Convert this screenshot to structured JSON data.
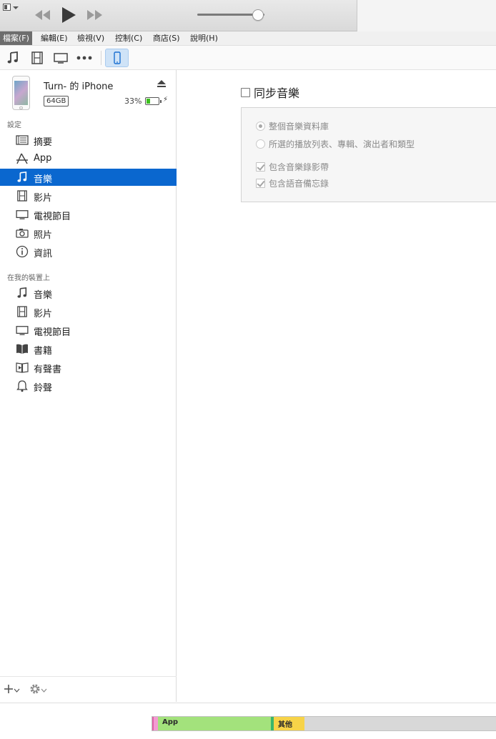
{
  "menu": {
    "items": [
      {
        "label": "檔案(F)",
        "active": true
      },
      {
        "label": "編輯(E)",
        "active": false
      },
      {
        "label": "檢視(V)",
        "active": false
      },
      {
        "label": "控制(C)",
        "active": false
      },
      {
        "label": "商店(S)",
        "active": false
      },
      {
        "label": "說明(H)",
        "active": false
      }
    ]
  },
  "player": {
    "volume_fraction": 0.9,
    "icons": [
      "rewind-icon",
      "play-icon",
      "fast-forward-icon"
    ]
  },
  "media_toolbar": {
    "icons": [
      "music-note-icon",
      "film-icon",
      "tv-icon",
      "more-dots-icon",
      "iphone-icon"
    ]
  },
  "device": {
    "name": "Turn- 的 iPhone",
    "capacity": "64GB",
    "battery_percent_text": "33%",
    "battery_fraction": 0.33,
    "charging_glyph": "⚡"
  },
  "sidebar": {
    "settings_title": "設定",
    "settings_items": [
      {
        "label": "摘要",
        "icon": "summary-list-icon",
        "selected": false
      },
      {
        "label": "App",
        "icon": "app-store-icon",
        "selected": false
      },
      {
        "label": "音樂",
        "icon": "music-note-icon",
        "selected": true
      },
      {
        "label": "影片",
        "icon": "film-icon",
        "selected": false
      },
      {
        "label": "電視節目",
        "icon": "tv-icon",
        "selected": false
      },
      {
        "label": "照片",
        "icon": "camera-icon",
        "selected": false
      },
      {
        "label": "資訊",
        "icon": "info-icon",
        "selected": false
      }
    ],
    "device_title": "在我的裝置上",
    "device_items": [
      {
        "label": "音樂",
        "icon": "music-note-icon"
      },
      {
        "label": "影片",
        "icon": "film-icon"
      },
      {
        "label": "電視節目",
        "icon": "tv-icon"
      },
      {
        "label": "書籍",
        "icon": "book-icon"
      },
      {
        "label": "有聲書",
        "icon": "audiobook-icon"
      },
      {
        "label": "鈴聲",
        "icon": "bell-icon"
      }
    ]
  },
  "main": {
    "sync_label": "同步音樂",
    "sync_checked": false,
    "options": {
      "entire_library": "整個音樂資料庫",
      "selected_items": "所選的播放列表、專輯、演出者和類型",
      "include_videos": "包含音樂錄影帶",
      "include_voice_memos": "包含語音備忘錄"
    }
  },
  "storage_bar": {
    "segments": [
      {
        "label": "",
        "color": "#e05fa6",
        "fraction": 0.004
      },
      {
        "label": "",
        "color": "#f39bd1",
        "fraction": 0.012
      },
      {
        "label": "App",
        "color": "#a3e27c",
        "fraction": 0.33
      },
      {
        "label": "",
        "color": "#3ab66b",
        "fraction": 0.008
      },
      {
        "label": "其他",
        "color": "#f7d348",
        "fraction": 0.09
      },
      {
        "label": "",
        "color": "#d8d8d8",
        "fraction": 0.556
      }
    ]
  }
}
